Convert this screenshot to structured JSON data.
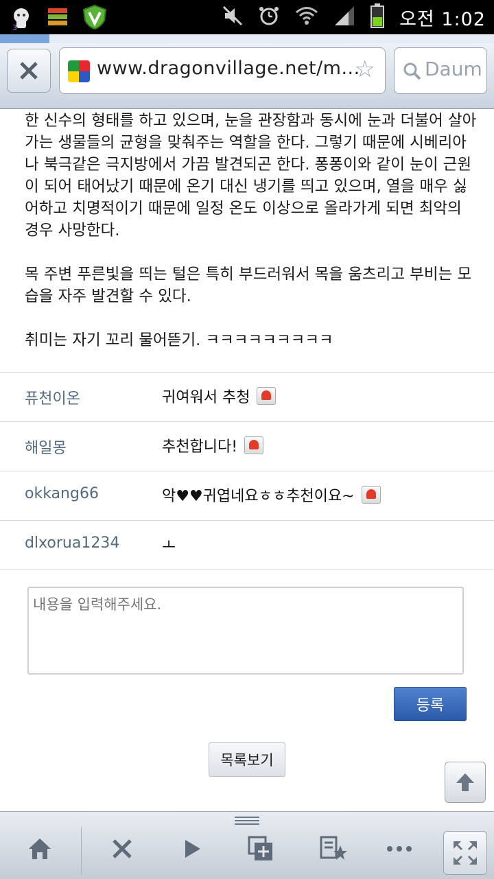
{
  "status_bar": {
    "time": "오전 1:02",
    "notification_badge": "3",
    "icons": [
      "ghost-app-icon",
      "stack-icon",
      "shield-v-icon",
      "mute-icon",
      "alarm-icon",
      "wifi-icon",
      "signal-icon",
      "battery-icon"
    ]
  },
  "browser": {
    "url": "www.dragonvillage.net/m...",
    "search_placeholder": "Daum",
    "load_progress": 0.1
  },
  "article": {
    "paragraphs": [
      "한 신수의 형태를 하고 있으며, 눈을 관장함과 동시에 눈과 더불어 살아가는 생물들의 균형을 맞춰주는 역할을 한다. 그렇기 때문에 시베리아나 북극같은 극지방에서 가끔 발견되곤 한다. 퐁퐁이와 같이 눈이 근원이 되어 태어났기 때문에 온기 대신 냉기를 띄고 있으며, 열을 매우 싫어하고 치명적이기 때문에 일정 온도 이상으로 올라가게 되면 최악의 경우 사망한다.",
      "목 주변 푸른빛을 띄는 털은 특히 부드러워서 목을 움츠리고 부비는 모습을 자주 발견할 수 있다.",
      "취미는 자기 꼬리 물어뜯기. ㅋㅋㅋㅋㅋㅋㅋㅋㅋ"
    ]
  },
  "comments": [
    {
      "author": "퓨천이온",
      "text": "귀여워서 추청",
      "report": true
    },
    {
      "author": "해일몽",
      "text": "추천합니다!",
      "report": true
    },
    {
      "author": "okkang66",
      "text": "악♥♥귀엽네요ㅎㅎ추천이요~",
      "report": true
    },
    {
      "author": "dlxorua1234",
      "text": "ㅗ",
      "report": false
    }
  ],
  "comment_form": {
    "placeholder": "내용을 입력해주세요.",
    "submit_label": "등록"
  },
  "list_button_label": "목록보기",
  "toolbar": {
    "items": [
      "home-icon",
      "stop-icon",
      "forward-icon",
      "new-window-icon",
      "bookmarks-icon",
      "more-icon",
      "fullscreen-icon"
    ]
  },
  "colors": {
    "accent_blue": "#2b5aa8",
    "comment_author": "#546a80"
  }
}
